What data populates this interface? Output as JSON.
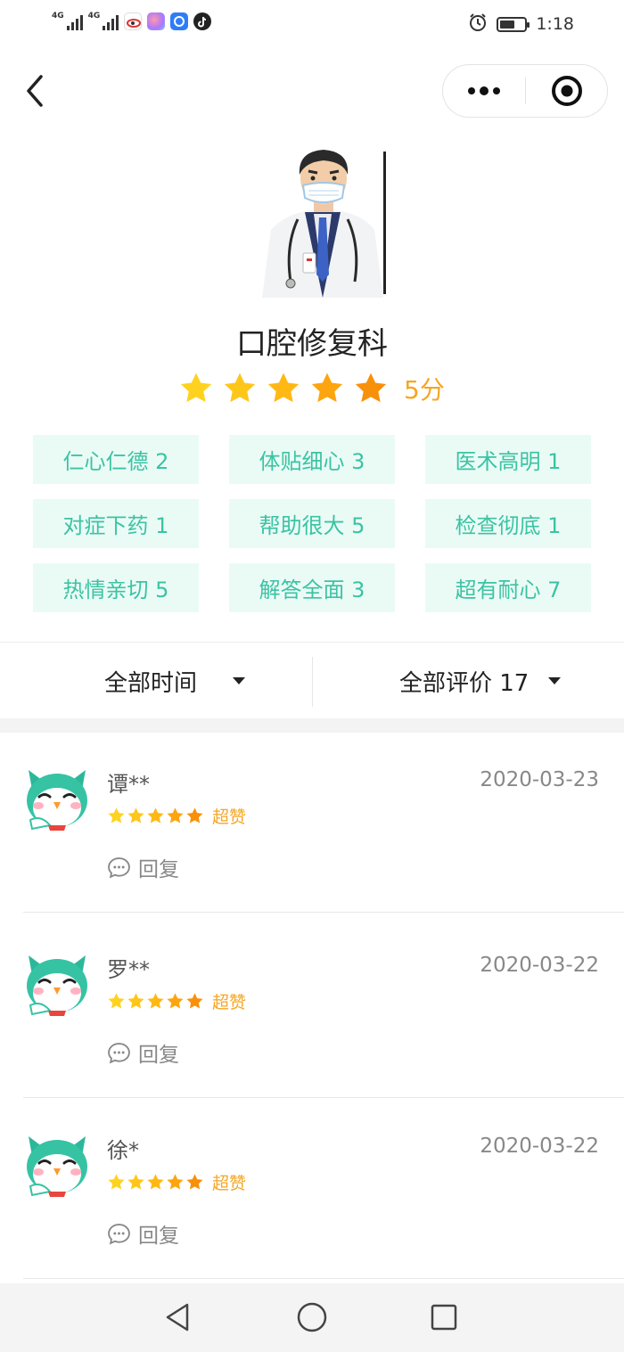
{
  "status_bar": {
    "network_1": "4G",
    "network_2": "4G",
    "time": "1:18",
    "icons": [
      "signal-icon",
      "signal-icon",
      "sina-icon",
      "app-icon",
      "app-icon",
      "tiktok-icon",
      "alarm-icon",
      "battery-icon"
    ],
    "battery_level": 0.6
  },
  "nav": {
    "back_icon": "chevron-left-icon",
    "more_icon": "more-dots-icon",
    "close_icon": "target-circle-icon"
  },
  "header": {
    "department": "口腔修复科",
    "rating_stars": 5,
    "score": "5分"
  },
  "tags": [
    "仁心仁德 2",
    "体贴细心 3",
    "医术高明 1",
    "对症下药 1",
    "帮助很大 5",
    "检查彻底 1",
    "热情亲切 5",
    "解答全面 3",
    "超有耐心 7"
  ],
  "filters": {
    "time": "全部时间",
    "reviews": "全部评价 17"
  },
  "reviews": [
    {
      "name": "谭**",
      "date": "2020-03-23",
      "stars": 5,
      "praise": "超赞",
      "reply": "回复"
    },
    {
      "name": "罗**",
      "date": "2020-03-22",
      "stars": 5,
      "praise": "超赞",
      "reply": "回复"
    },
    {
      "name": "徐*",
      "date": "2020-03-22",
      "stars": 5,
      "praise": "超赞",
      "reply": "回复"
    }
  ],
  "colors": {
    "accent_green": "#3cc3a3",
    "tag_bg": "#eafbf6",
    "star_gold": "#f5a623",
    "star_yellow": "#ffd21f"
  }
}
